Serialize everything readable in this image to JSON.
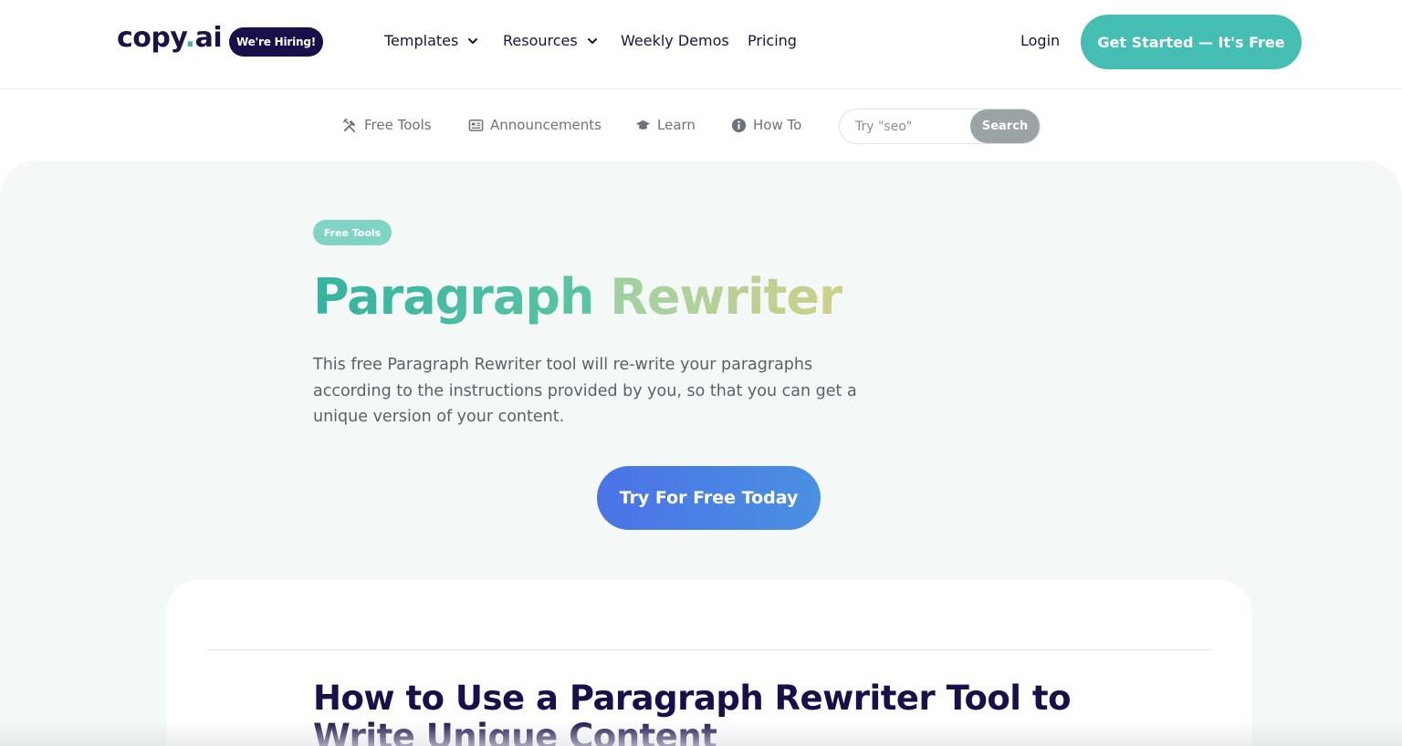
{
  "header": {
    "logo_main": "copy",
    "logo_dot": ".",
    "logo_suffix": "ai",
    "hiring_badge": "We're Hiring!",
    "nav": {
      "templates": "Templates",
      "resources": "Resources",
      "weekly_demos": "Weekly Demos",
      "pricing": "Pricing"
    },
    "login": "Login",
    "cta": "Get Started — It's Free"
  },
  "subnav": {
    "items": [
      {
        "label": "Free Tools",
        "icon": "tools-icon"
      },
      {
        "label": "Announcements",
        "icon": "newspaper-icon"
      },
      {
        "label": "Learn",
        "icon": "graduation-cap-icon"
      },
      {
        "label": "How To",
        "icon": "info-circle-icon"
      }
    ],
    "search_placeholder": "Try \"seo\"",
    "search_button": "Search"
  },
  "hero": {
    "badge": "Free Tools",
    "title_part1": "Paragraph",
    "title_part2": "Rewriter",
    "description": "This free Paragraph Rewriter tool will re-write your paragraphs according to the instructions provided by you, so that you can get a unique version of your content.",
    "cta": "Try For Free Today"
  },
  "article": {
    "title": "How to Use a Paragraph Rewriter Tool to Write Unique Content"
  },
  "colors": {
    "brand_dark": "#1b0f4a",
    "teal": "#45bfb3",
    "cta_blue": "#4b73e6",
    "hero_bg": "#f4f8f7"
  }
}
